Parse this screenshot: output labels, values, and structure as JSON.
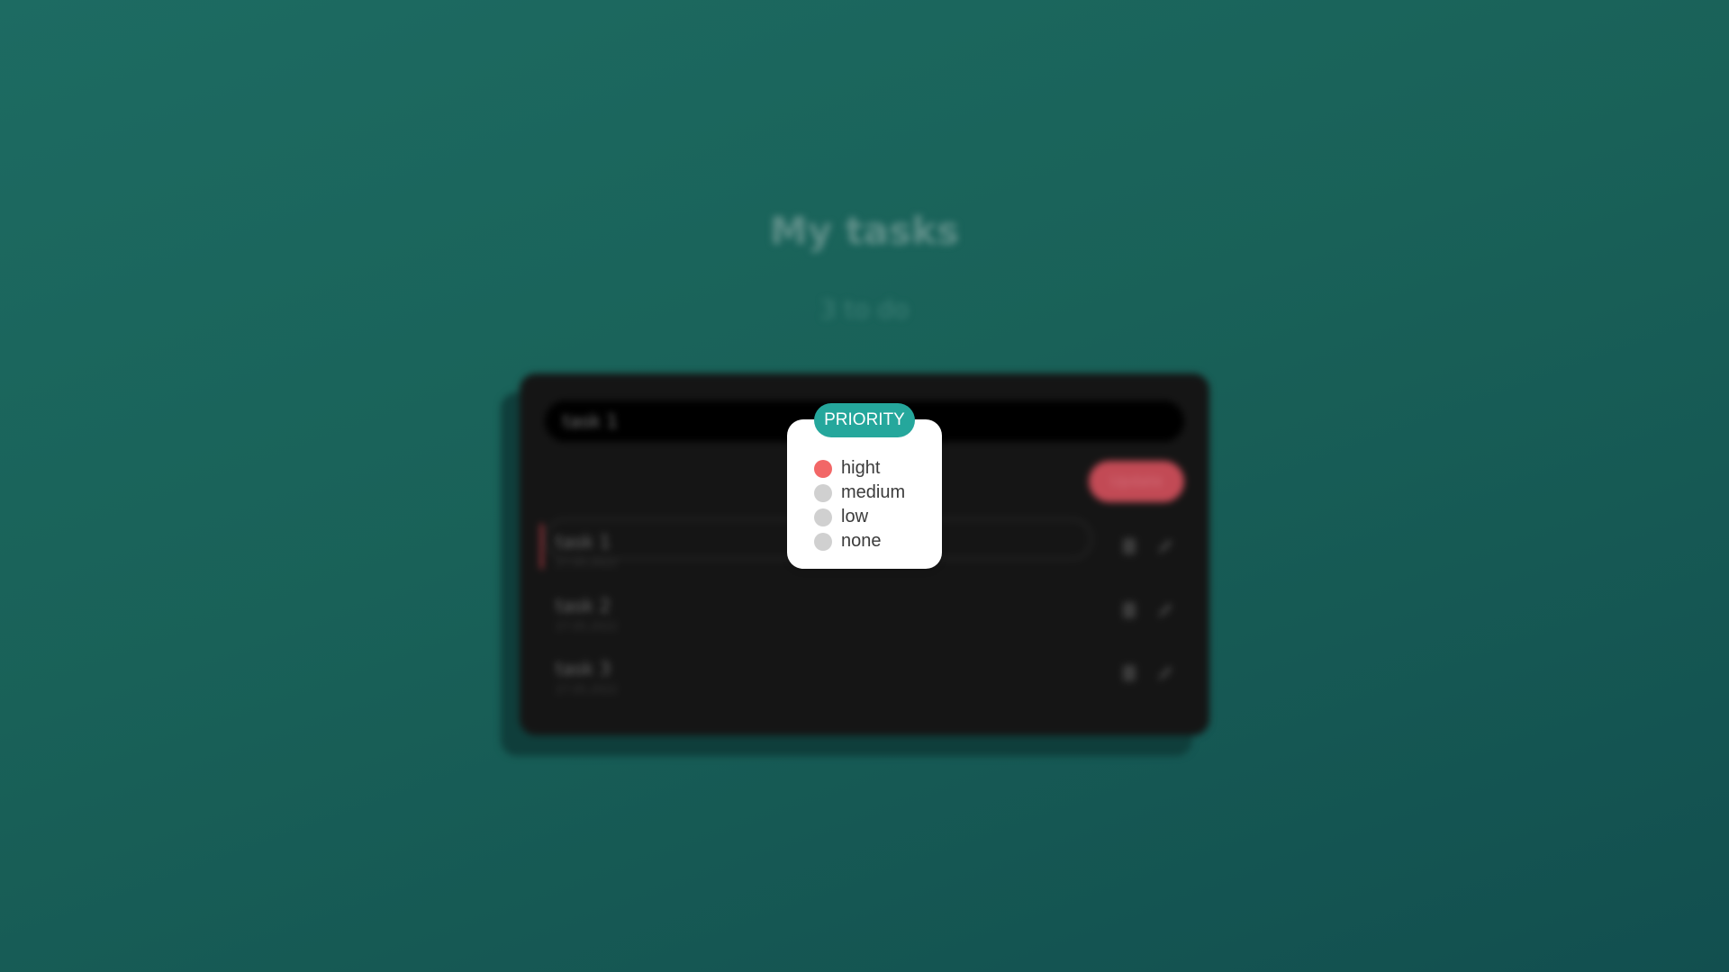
{
  "page": {
    "title": "My tasks",
    "subtitle": "3 to do"
  },
  "editor": {
    "input_value": "task 1",
    "update_label": "Update"
  },
  "tasks": [
    {
      "name": "task 1",
      "date": "27.05.2022",
      "editing": true
    },
    {
      "name": "task 2",
      "date": "27.05.2022",
      "editing": false
    },
    {
      "name": "task 3",
      "date": "27.05.2022",
      "editing": false
    }
  ],
  "priority_popup": {
    "title": "PRIORITY",
    "selected": "hight",
    "options": [
      {
        "label": "hight",
        "color": "#f26767"
      },
      {
        "label": "medium",
        "color": "#d0d0d0"
      },
      {
        "label": "low",
        "color": "#d0d0d0"
      },
      {
        "label": "none",
        "color": "#d0d0d0"
      }
    ]
  },
  "colors": {
    "accent": "#25a79c",
    "high_priority": "#f26767",
    "update_button": "#c24a55",
    "card_background": "#151515"
  },
  "icons": {
    "delete": "trash-icon",
    "edit": "pencil-icon"
  }
}
